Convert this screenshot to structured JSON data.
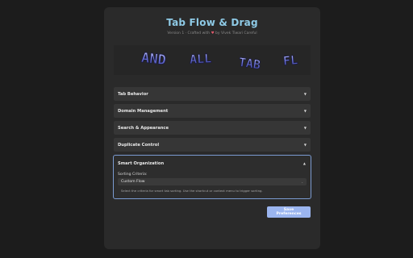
{
  "app": {
    "title": "Tab Flow & Drag",
    "subtitle_prefix": "Version 1 · Crafted with",
    "subtitle_suffix": "by Vivek Tiwari Careful"
  },
  "banner": {
    "text_words": [
      "AND",
      "ALL",
      "TAB",
      "FL"
    ]
  },
  "sections": [
    {
      "label": "Tab Behavior",
      "state": "collapsed"
    },
    {
      "label": "Domain Management",
      "state": "collapsed"
    },
    {
      "label": "Search & Appearance",
      "state": "collapsed"
    },
    {
      "label": "Duplicate Control",
      "state": "collapsed"
    },
    {
      "label": "Smart Organization",
      "state": "expanded"
    }
  ],
  "smart": {
    "criteria_label": "Sorting Criteria:",
    "select_value": "Custom Flow",
    "hint": "Select the criteria for smart tab sorting. Use the shortcut or context menu to trigger sorting."
  },
  "actions": {
    "save_label": "Save Preferences"
  },
  "icons": {
    "caret_down": "▼",
    "caret_up": "▲",
    "select_chevron": "⌄",
    "heart": "♥"
  },
  "colors": {
    "title": "#8ecae6",
    "accent_border": "#7b9bd1",
    "save_button": "#9bb5ef",
    "heart": "#e05a6b"
  }
}
